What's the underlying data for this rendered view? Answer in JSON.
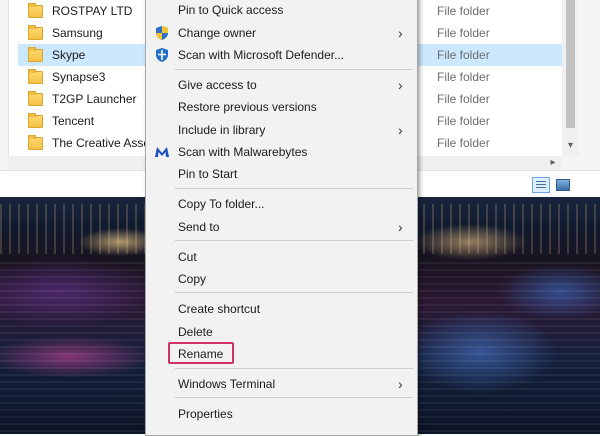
{
  "files": [
    {
      "name": "ROSTPAY LTD",
      "type": "File folder",
      "selected": false
    },
    {
      "name": "Samsung",
      "type": "File folder",
      "selected": false
    },
    {
      "name": "Skype",
      "type": "File folder",
      "selected": true
    },
    {
      "name": "Synapse3",
      "type": "File folder",
      "selected": false
    },
    {
      "name": "T2GP Launcher",
      "type": "File folder",
      "selected": false
    },
    {
      "name": "Tencent",
      "type": "File folder",
      "selected": false
    },
    {
      "name": "The Creative Assembly",
      "type": "File folder",
      "selected": false
    }
  ],
  "context_menu": {
    "items": [
      {
        "label": "Pin to Quick access",
        "icon": null,
        "submenu": false
      },
      {
        "label": "Change owner",
        "icon": "shield-icon",
        "submenu": true
      },
      {
        "label": "Scan with Microsoft Defender...",
        "icon": "defender-icon",
        "submenu": false
      },
      {
        "label": "Give access to",
        "icon": null,
        "submenu": true
      },
      {
        "label": "Restore previous versions",
        "icon": null,
        "submenu": false
      },
      {
        "label": "Include in library",
        "icon": null,
        "submenu": true
      },
      {
        "label": "Scan with Malwarebytes",
        "icon": "malwarebytes-icon",
        "submenu": false
      },
      {
        "label": "Pin to Start",
        "icon": null,
        "submenu": false
      },
      {
        "label": "Copy To folder...",
        "icon": null,
        "submenu": false
      },
      {
        "label": "Send to",
        "icon": null,
        "submenu": true
      },
      {
        "label": "Cut",
        "icon": null,
        "submenu": false
      },
      {
        "label": "Copy",
        "icon": null,
        "submenu": false
      },
      {
        "label": "Create shortcut",
        "icon": null,
        "submenu": false
      },
      {
        "label": "Delete",
        "icon": null,
        "submenu": false
      },
      {
        "label": "Rename",
        "icon": null,
        "submenu": false,
        "highlighted": true
      },
      {
        "label": "Windows Terminal",
        "icon": null,
        "submenu": true
      },
      {
        "label": "Properties",
        "icon": null,
        "submenu": false
      }
    ],
    "submenu_arrow": "›"
  },
  "scrollbar": {
    "down_arrow": "▾",
    "right_arrow": "▸"
  },
  "colors": {
    "selection": "#cce8ff",
    "highlight_border": "#d0336a"
  }
}
